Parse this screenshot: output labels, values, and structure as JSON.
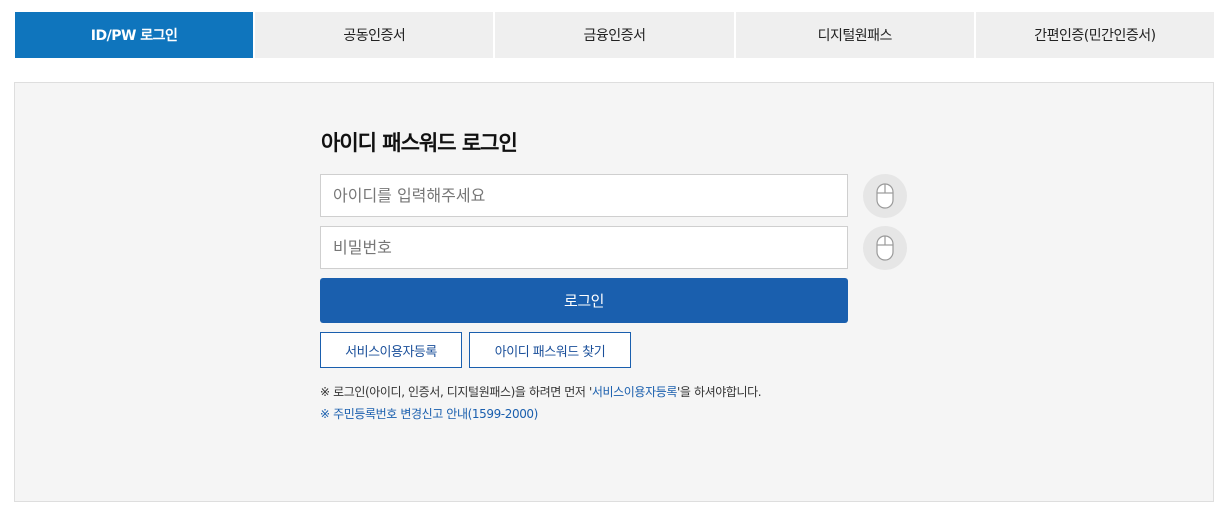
{
  "tabs": [
    {
      "label": "ID/PW 로그인",
      "active": true
    },
    {
      "label": "공동인증서",
      "active": false
    },
    {
      "label": "금융인증서",
      "active": false
    },
    {
      "label": "디지털원패스",
      "active": false
    },
    {
      "label": "간편인증(민간인증서)",
      "active": false
    }
  ],
  "login": {
    "title": "아이디 패스워드 로그인",
    "id_placeholder": "아이디를 입력해주세요",
    "pw_placeholder": "비밀번호",
    "submit_label": "로그인",
    "register_label": "서비스이용자등록",
    "find_label": "아이디 패스워드 찾기"
  },
  "notice": {
    "prefix": "※ 로그인(아이디, 인증서, 디지털원패스)을 하려면 먼저 '",
    "highlight": "서비스이용자등록",
    "suffix": "'을 하셔야합니다.",
    "link": "※ 주민등록번호 변경신고 안내(1599-2000)"
  },
  "colors": {
    "accent": "#0f75bd",
    "primary_button": "#1a5fae"
  },
  "icons": {
    "virtual_keyboard": "mouse-icon"
  }
}
